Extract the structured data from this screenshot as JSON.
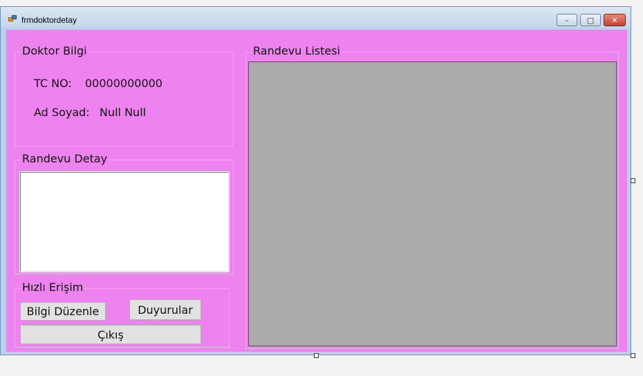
{
  "window": {
    "title": "frmdoktordetay"
  },
  "title_controls": {
    "minimize": "–",
    "maximize": "□",
    "close": "✕"
  },
  "doktor_bilgi": {
    "title": "Doktor Bilgi",
    "tc_label": "TC NO:",
    "tc_value": "00000000000",
    "adsoyad_label": "Ad Soyad:",
    "adsoyad_value": "Null Null"
  },
  "randevu_detay": {
    "title": "Randevu Detay",
    "text": ""
  },
  "hizli_erisim": {
    "title": "Hızlı Erişim",
    "bilgi_duzenle": "Bilgi Düzenle",
    "duyurular": "Duyurular",
    "cikis": "Çıkış"
  },
  "randevu_listesi": {
    "title": "Randevu Listesi"
  },
  "colors": {
    "form_background": "#ee82ee",
    "grid_background": "#ababab"
  }
}
